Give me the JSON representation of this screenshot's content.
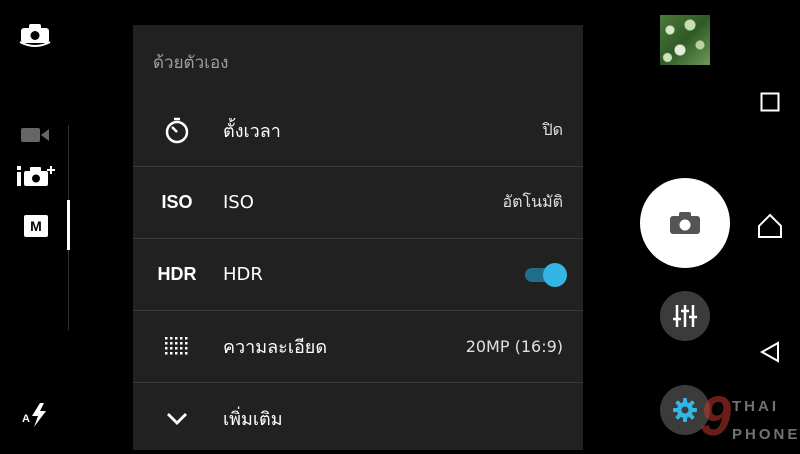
{
  "left_rail": {
    "icons": [
      {
        "name": "switch-camera-icon"
      },
      {
        "name": "video-mode-icon"
      },
      {
        "name": "photo-plus-mode-icon"
      },
      {
        "name": "manual-mode-icon",
        "label": "M"
      },
      {
        "name": "auto-flash-icon"
      }
    ]
  },
  "settings_panel": {
    "title": "ด้วยตัวเอง",
    "rows": [
      {
        "icon": "timer-icon",
        "label": "ตั้งเวลา",
        "value": "ปิด"
      },
      {
        "icon": "iso-icon",
        "icon_text": "ISO",
        "label": "ISO",
        "value": "อัตโนมัติ"
      },
      {
        "icon": "hdr-icon",
        "icon_text": "HDR",
        "label": "HDR",
        "toggle_on": true
      },
      {
        "icon": "resolution-grid-icon",
        "label": "ความละเอียด",
        "value": "20MP (16:9)"
      },
      {
        "icon": "chevron-down-icon",
        "label": "เพิ่มเติม"
      }
    ]
  },
  "colors": {
    "panel_bg": "#212121",
    "toggle_accent": "#33b5e5",
    "watermark_accent": "#c0392b"
  },
  "watermark": {
    "top": "THAI",
    "bottom": "PHONE",
    "digit": "9"
  }
}
